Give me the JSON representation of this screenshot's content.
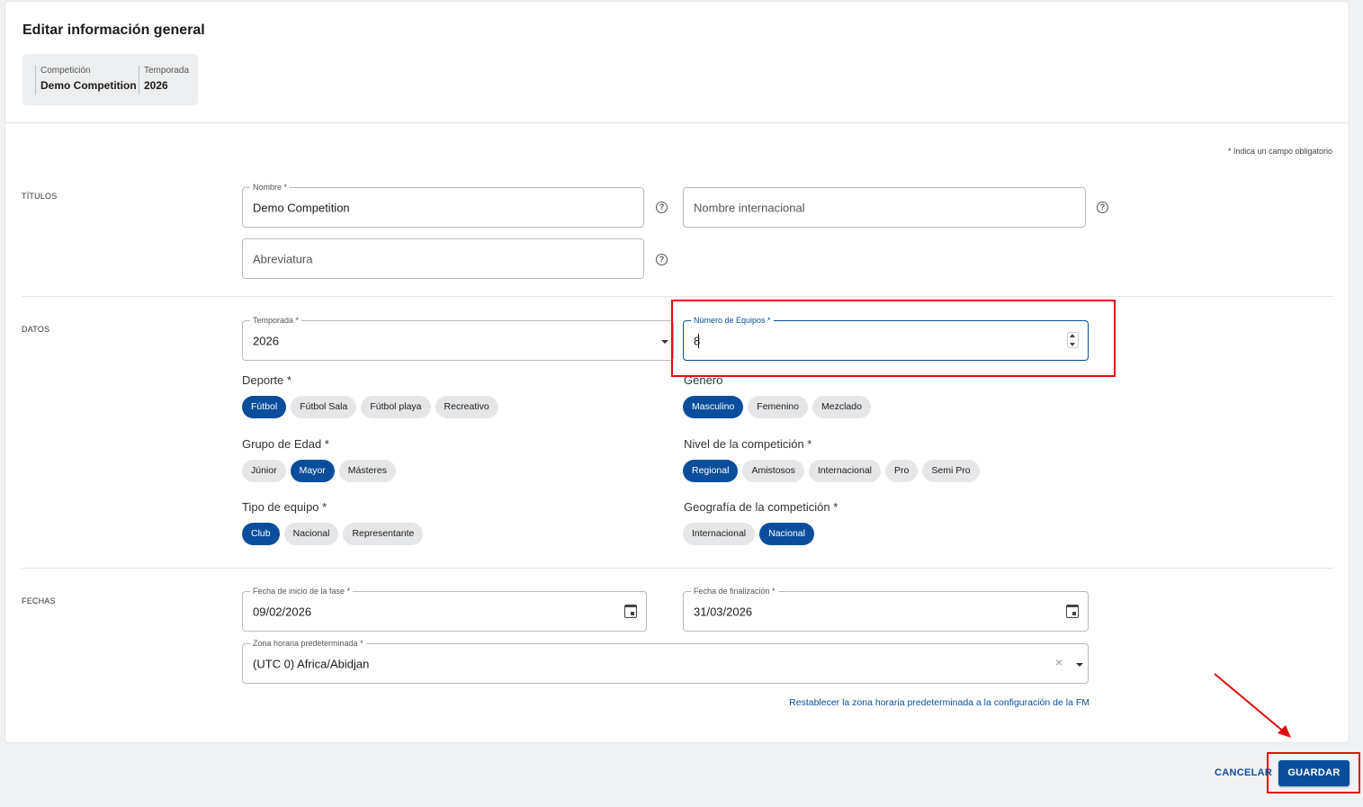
{
  "page": {
    "title": "Editar información general",
    "required_note": "* Indica un campo obligatorio"
  },
  "meta": {
    "competition_label": "Competición",
    "competition_value": "Demo Competition",
    "season_label": "Temporada",
    "season_value": "2026"
  },
  "sections": {
    "titles": "TÍTULOS",
    "data": "DATOS",
    "dates": "FECHAS"
  },
  "titles": {
    "name_label": "Nombre *",
    "name_value": "Demo Competition",
    "intl_name_placeholder": "Nombre internacional",
    "abbr_placeholder": "Abreviatura"
  },
  "data": {
    "season_label": "Temporada *",
    "season_value": "2026",
    "teams_label": "Número de Equipos *",
    "teams_value": "8",
    "sport": {
      "title": "Deporte *",
      "options": [
        "Fútbol",
        "Fútbol Sala",
        "Fútbol playa",
        "Recreativo"
      ],
      "selected": "Fútbol"
    },
    "gender": {
      "title": "Género",
      "options": [
        "Masculino",
        "Femenino",
        "Mezclado"
      ],
      "selected": "Masculino"
    },
    "age_group": {
      "title": "Grupo de Edad *",
      "options": [
        "Júnior",
        "Mayor",
        "Másteres"
      ],
      "selected": "Mayor"
    },
    "level": {
      "title": "Nivel de la competición *",
      "options": [
        "Regional",
        "Amistosos",
        "Internacional",
        "Pro",
        "Semi Pro"
      ],
      "selected": "Regional"
    },
    "team_type": {
      "title": "Tipo de equipo *",
      "options": [
        "Club",
        "Nacional",
        "Representante"
      ],
      "selected": "Club"
    },
    "geography": {
      "title": "Geografía de la competición *",
      "options": [
        "Internacional",
        "Nacional"
      ],
      "selected": "Nacional"
    }
  },
  "dates": {
    "start_label": "Fecha de inicio de la fase *",
    "start_value": "09/02/2026",
    "end_label": "Fecha de finalización *",
    "end_value": "31/03/2026",
    "tz_label": "Zona horaria predeterminada *",
    "tz_value": "(UTC 0) Africa/Abidjan",
    "tz_reset_link": "Restablecer la zona horaria predeterminada a la configuración de la FM"
  },
  "footer": {
    "cancel": "CANCELAR",
    "save": "GUARDAR"
  },
  "colors": {
    "accent": "#0a4e9b",
    "highlight": "#e01010",
    "chip_bg": "#e5e6e8"
  }
}
